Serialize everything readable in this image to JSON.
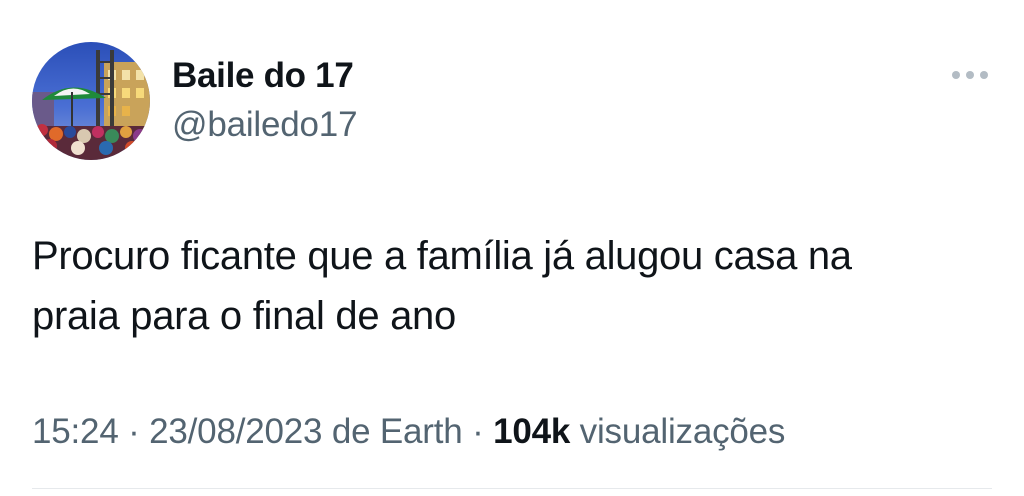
{
  "author": {
    "name": "Baile do 17",
    "handle": "@bailedo17",
    "avatar_icon": "party-crowd-avatar"
  },
  "more_menu": {
    "icon": "more-horizontal-icon"
  },
  "tweet": {
    "text_line1": "Procuro ficante que a família já alugou casa na",
    "text_line2": "praia para o final de ano"
  },
  "meta": {
    "time": "15:24",
    "separator": "·",
    "date": "23/08/2023",
    "source": "de Earth",
    "views_count": "104k",
    "views_label": "visualizações"
  },
  "colors": {
    "text_primary": "#0f1419",
    "text_secondary": "#536471",
    "divider": "#e6e9ec"
  }
}
